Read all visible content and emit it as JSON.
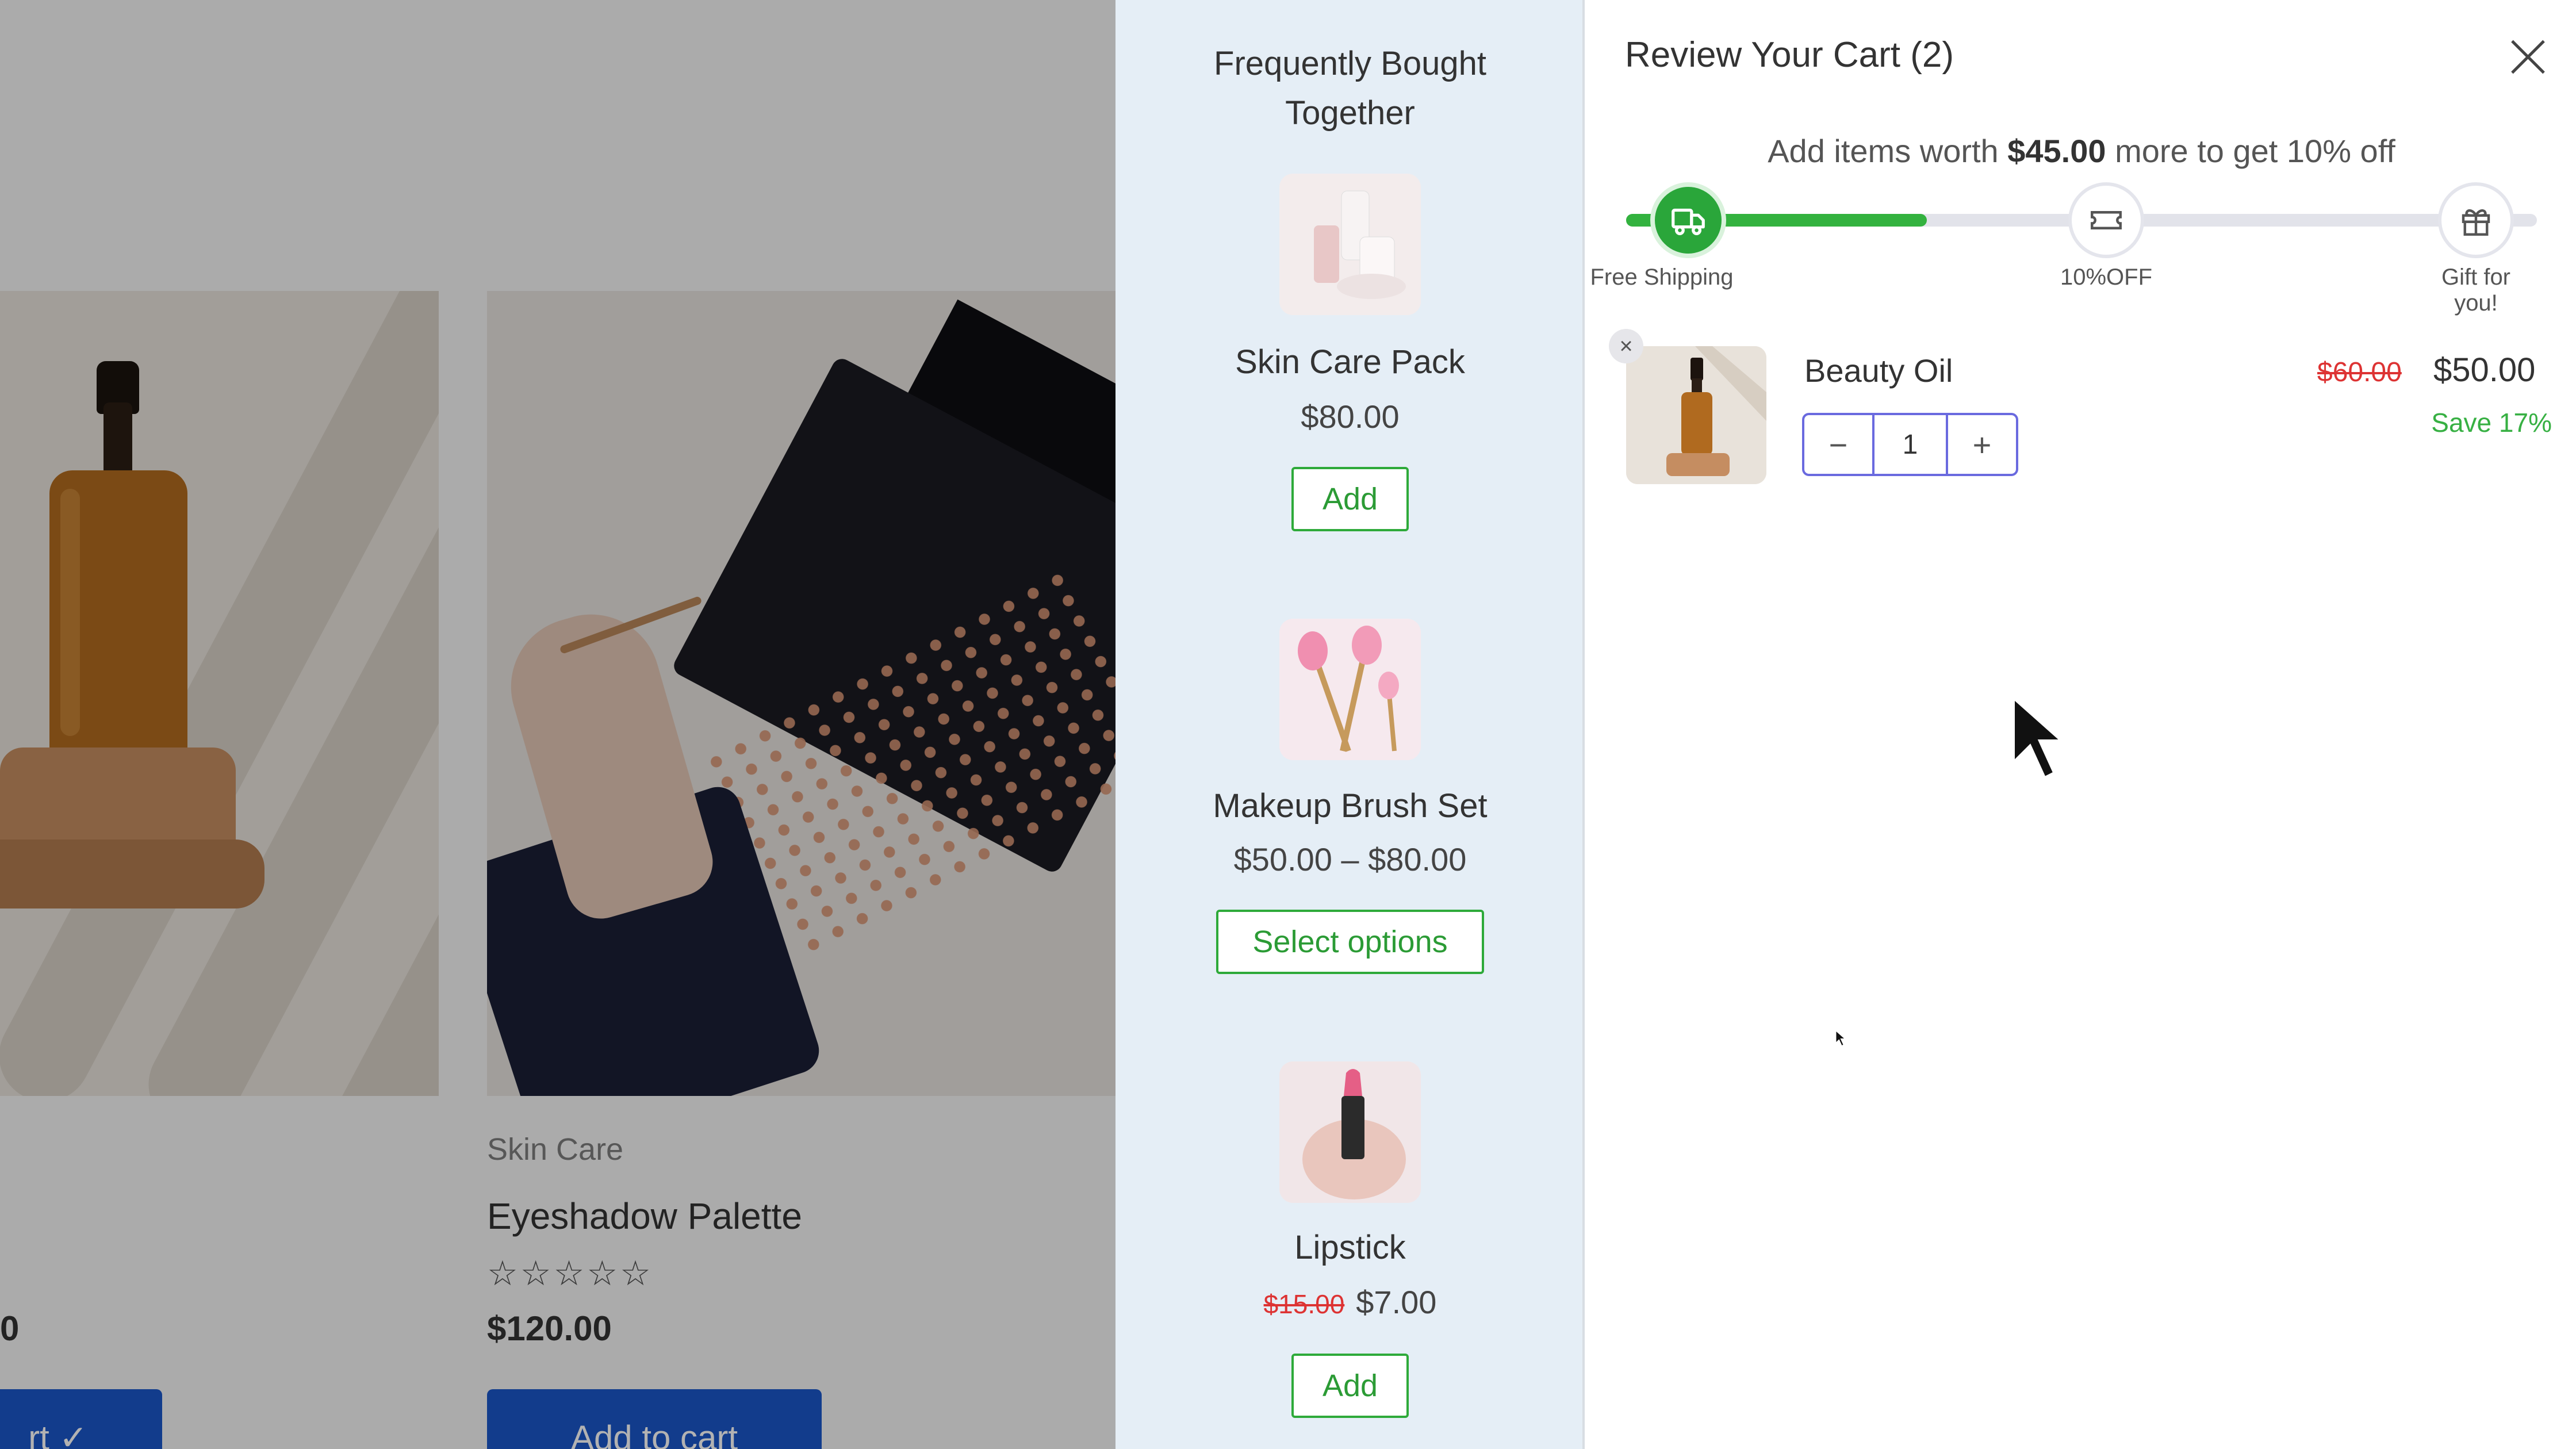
{
  "products": {
    "left_price_fragment": "0",
    "left_button": "rt ✓",
    "card2": {
      "category": "Skin Care",
      "name": "Eyeshadow Palette",
      "rating_stars": "☆☆☆☆☆",
      "price": "$120.00",
      "button": "Add to cart"
    }
  },
  "fbt": {
    "title_line1": "Frequently Bought",
    "title_line2": "Together",
    "items": [
      {
        "name": "Skin Care Pack",
        "price": "$80.00",
        "button": "Add"
      },
      {
        "name": "Makeup Brush Set",
        "price": "$50.00 – $80.00",
        "button": "Select options"
      },
      {
        "name": "Lipstick",
        "old_price": "$15.00",
        "price": "$7.00",
        "button": "Add"
      }
    ]
  },
  "cart": {
    "title": "Review Your Cart (2)",
    "promo_pre": "Add items worth ",
    "promo_amount": "$45.00",
    "promo_post": " more to get 10% off",
    "progress_percent": 33,
    "milestones": [
      {
        "label": "Free Shipping",
        "icon": "truck-icon"
      },
      {
        "label": "10%OFF",
        "icon": "ticket-icon"
      },
      {
        "label_line1": "Gift for",
        "label_line2": "you!",
        "icon": "gift-icon"
      }
    ],
    "line_item": {
      "name": "Beauty Oil",
      "quantity": "1",
      "old_price": "$60.00",
      "price": "$50.00",
      "save": "Save 17%"
    }
  },
  "colors": {
    "accent_green": "#2aa63a",
    "primary_blue": "#1b56c9",
    "sale_red": "#dd3333",
    "qty_border": "#6a6adf"
  }
}
